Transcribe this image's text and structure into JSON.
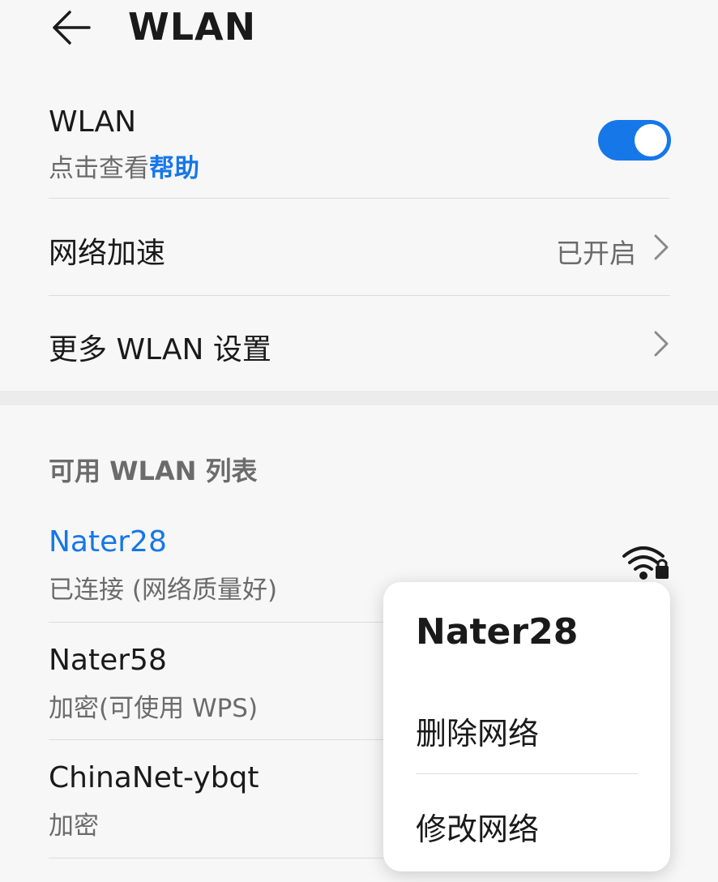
{
  "header": {
    "back_icon": "arrow-left-icon",
    "title": "WLAN"
  },
  "wlan_toggle_row": {
    "title": "WLAN",
    "subtitle_prefix": "点击查看",
    "subtitle_link": "帮助",
    "toggle_on": true,
    "accent_color": "#1677e8"
  },
  "network_accel_row": {
    "title": "网络加速",
    "status": "已开启",
    "chevron_icon": "chevron-right-icon"
  },
  "more_settings_row": {
    "title": "更多 WLAN 设置",
    "chevron_icon": "chevron-right-icon"
  },
  "available_list": {
    "header": "可用 WLAN 列表",
    "networks": [
      {
        "name": "Nater28",
        "status": "已连接 (网络质量好)",
        "connected": true,
        "icon": "wifi-lock-icon"
      },
      {
        "name": "Nater58",
        "status": "加密(可使用 WPS)",
        "connected": false
      },
      {
        "name": "ChinaNet-ybqt",
        "status": "加密",
        "connected": false
      }
    ]
  },
  "context_menu": {
    "title": "Nater28",
    "items": [
      {
        "label": "删除网络"
      },
      {
        "label": "修改网络"
      }
    ]
  }
}
